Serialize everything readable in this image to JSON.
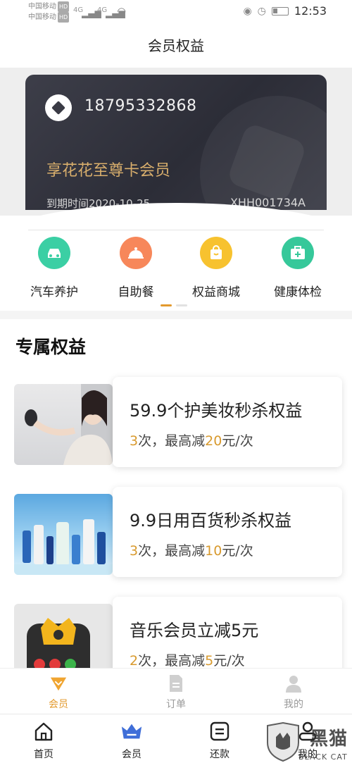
{
  "status_bar": {
    "carrier1": "中国移动",
    "carrier2": "中国移动",
    "hd": "HD",
    "signal1": "4G",
    "signal2": "4G",
    "time": "12:53"
  },
  "header": {
    "title": "会员权益"
  },
  "card": {
    "phone": "18795332868",
    "title": "享花花至尊卡会员",
    "expire": "到期时间2020-10-25",
    "code": "XHH001734A"
  },
  "quick_items": [
    {
      "label": "汽车养护",
      "color": "#3bcfa4",
      "icon": "car-icon"
    },
    {
      "label": "自助餐",
      "color": "#f7875a",
      "icon": "dining-bell-icon"
    },
    {
      "label": "权益商城",
      "color": "#f7c22f",
      "icon": "shopping-bag-icon"
    },
    {
      "label": "健康体检",
      "color": "#36c89a",
      "icon": "medical-kit-icon"
    }
  ],
  "colors": {
    "accent": "#d89a2e",
    "nav_active": "#3f6ed8",
    "tab_active": "#e39a2d"
  },
  "section": {
    "title": "专属权益",
    "benefits": [
      {
        "title": "59.9个护美妆秒杀权益",
        "count": "3",
        "mid": "次，最高减",
        "amount": "20",
        "unit": "元/次"
      },
      {
        "title": "9.9日用百货秒杀权益",
        "count": "3",
        "mid": "次，最高减",
        "amount": "10",
        "unit": "元/次"
      },
      {
        "title": "音乐会员立减5元",
        "count": "2",
        "mid": "次，最高减",
        "amount": "5",
        "unit": "元/次"
      }
    ]
  },
  "sub_tabs": [
    {
      "label": "会员",
      "icon": "crown-badge-icon",
      "active": true
    },
    {
      "label": "订单",
      "icon": "document-icon",
      "active": false
    },
    {
      "label": "我的",
      "icon": "user-icon",
      "active": false
    }
  ],
  "bottom_nav": [
    {
      "label": "首页",
      "icon": "home-icon"
    },
    {
      "label": "会员",
      "icon": "crown-icon"
    },
    {
      "label": "还款",
      "icon": "bill-icon"
    },
    {
      "label": "我的",
      "icon": "person-icon"
    }
  ],
  "watermark": {
    "text": "黑猫",
    "sub": "BLACK CAT"
  }
}
